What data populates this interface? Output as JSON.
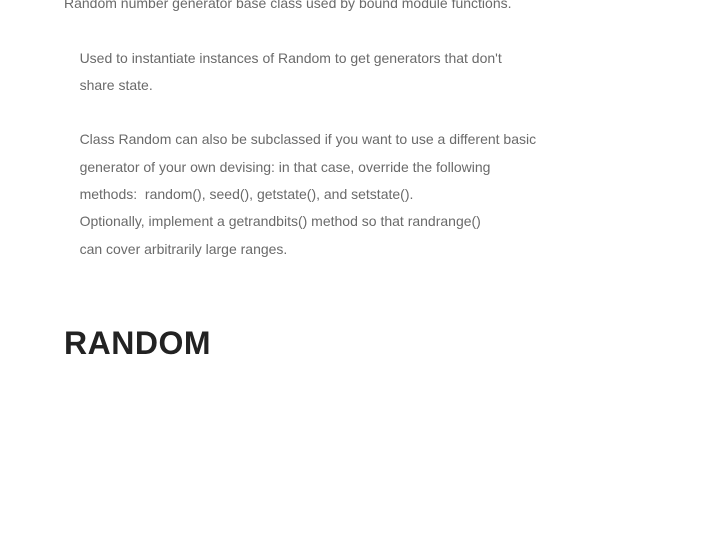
{
  "docstring": {
    "text": "Random number generator base class used by bound module functions.\n\n    Used to instantiate instances of Random to get generators that don't\n    share state.\n\n    Class Random can also be subclassed if you want to use a different basic\n    generator of your own devising: in that case, override the following\n    methods:  random(), seed(), getstate(), and setstate().\n    Optionally, implement a getrandbits() method so that randrange()\n    can cover arbitrarily large ranges."
  },
  "section": {
    "heading": "RANDOM"
  }
}
